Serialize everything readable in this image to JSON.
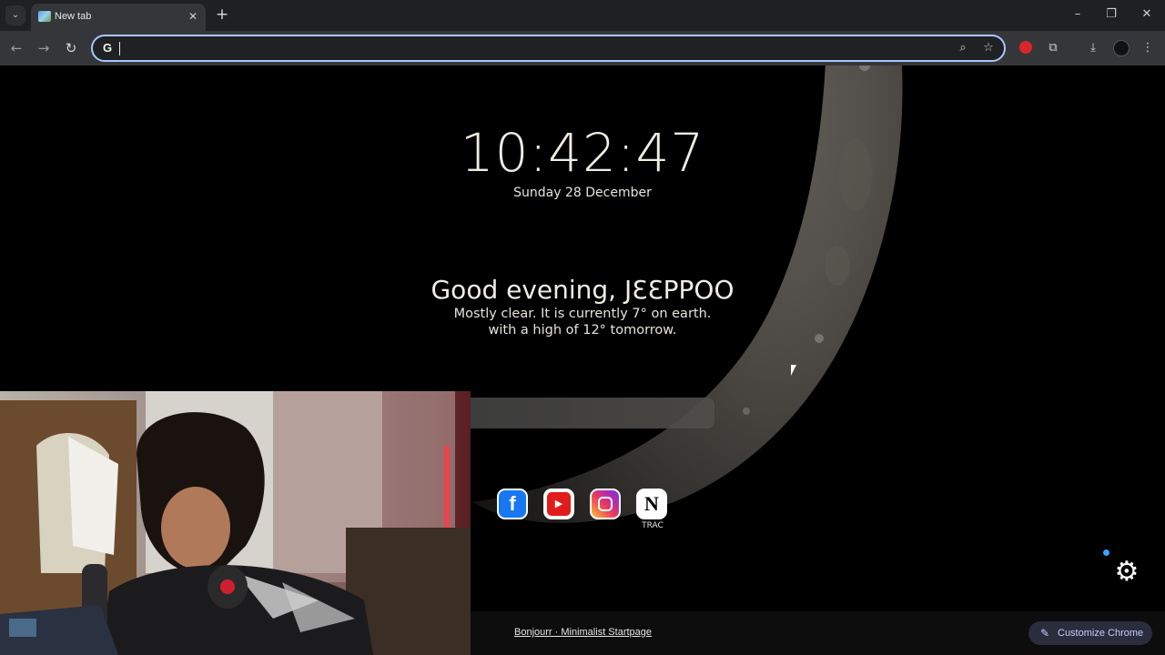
{
  "browser": {
    "tab_title": "New tab",
    "tab_close": "✕",
    "new_tab": "+",
    "tab_search": "⌄",
    "window_controls": {
      "minimize": "–",
      "restore": "❐",
      "close": "✕"
    },
    "nav": {
      "back": "←",
      "forward": "→",
      "reload": "↻"
    },
    "omnibox": {
      "value": "",
      "google_logo": "G",
      "zoom_icon": "⌕",
      "star_icon": "☆"
    },
    "toolbar_icons": {
      "extensions": "⧉",
      "downloads": "⤓",
      "menu": "⋮"
    }
  },
  "startpage": {
    "clock": "10:42:47",
    "date": "Sunday 28 December",
    "greeting": "Good evening, JƐƐPPOO",
    "weather_line1": "Mostly clear. It is currently 7° on earth.",
    "weather_line2": "with a high of 12° tomorrow.",
    "links": [
      {
        "name": "facebook",
        "glyph": "f"
      },
      {
        "name": "youtube",
        "glyph": "▶"
      },
      {
        "name": "instagram",
        "glyph": ""
      },
      {
        "name": "notion",
        "glyph": "N",
        "label": "TRAC"
      }
    ],
    "settings_icon": "⚙",
    "footer_link": "Bonjourr · Minimalist Startpage",
    "customize_label": "Customize Chrome",
    "customize_icon": "✎"
  },
  "colors": {
    "accent_focus": "#a8c7fa",
    "customize_bg": "#2a2d3d",
    "status_dot": "#3ea0ff"
  }
}
